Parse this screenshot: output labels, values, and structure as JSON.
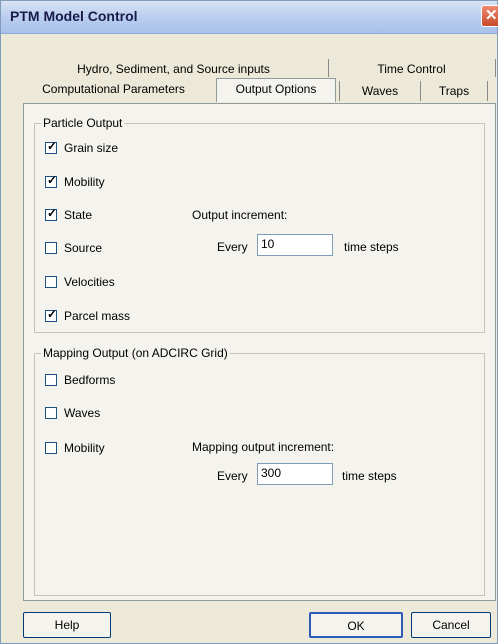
{
  "window": {
    "title": "PTM Model Control"
  },
  "tabs": {
    "row1": [
      "Hydro, Sediment, and Source inputs",
      "Time Control"
    ],
    "row2": [
      "Computational Parameters",
      "Output Options",
      "Waves",
      "Traps"
    ],
    "active": "Output Options"
  },
  "particle_output": {
    "title": "Particle Output",
    "items": [
      {
        "label": "Grain size",
        "checked": true
      },
      {
        "label": "Mobility",
        "checked": true
      },
      {
        "label": "State",
        "checked": true
      },
      {
        "label": "Source",
        "checked": false
      },
      {
        "label": "Velocities",
        "checked": false
      },
      {
        "label": "Parcel mass",
        "checked": true
      }
    ],
    "increment_label": "Output increment:",
    "every_label": "Every",
    "value": "10",
    "unit_label": "time steps"
  },
  "mapping_output": {
    "title": "Mapping Output (on ADCIRC Grid)",
    "items": [
      {
        "label": "Bedforms",
        "checked": false
      },
      {
        "label": "Waves",
        "checked": false
      },
      {
        "label": "Mobility",
        "checked": false
      }
    ],
    "increment_label": "Mapping output increment:",
    "every_label": "Every",
    "value": "300",
    "unit_label": "time steps"
  },
  "buttons": {
    "help": "Help",
    "ok": "OK",
    "cancel": "Cancel"
  }
}
